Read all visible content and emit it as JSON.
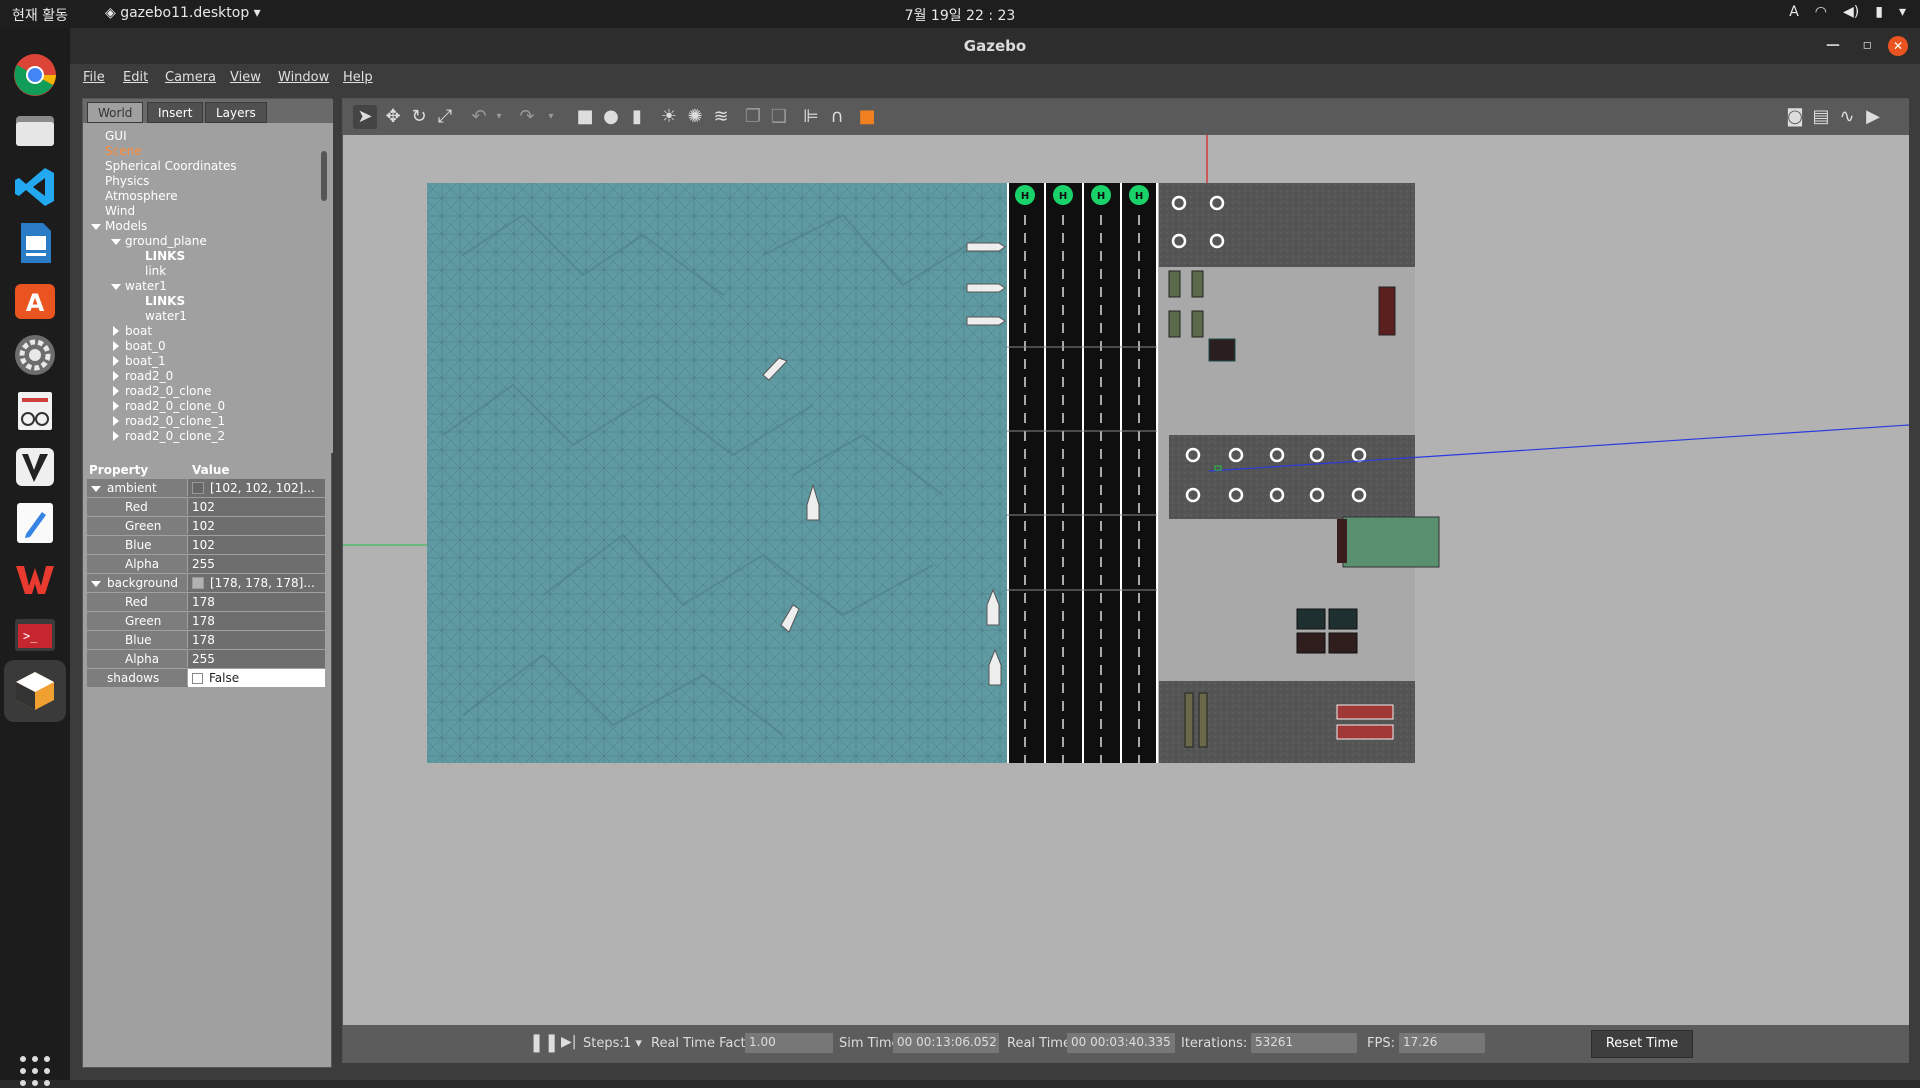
{
  "topbar": {
    "activities": "현재 활동",
    "app_name": "gazebo11.desktop",
    "clock": "7월 19일  22 : 23",
    "tray_input": "A"
  },
  "window": {
    "title": "Gazebo"
  },
  "menu": {
    "file": "File",
    "edit": "Edit",
    "camera": "Camera",
    "view": "View",
    "window": "Window",
    "help": "Help"
  },
  "tabs": {
    "world": "World",
    "insert": "Insert",
    "layers": "Layers"
  },
  "tree": {
    "gui": "GUI",
    "scene": "Scene",
    "spherical": "Spherical Coordinates",
    "physics": "Physics",
    "atmosphere": "Atmosphere",
    "wind": "Wind",
    "models": "Models",
    "ground_plane": "ground_plane",
    "links_1": "LINKS",
    "link": "link",
    "water1": "water1",
    "links_2": "LINKS",
    "water1_link": "water1",
    "boat": "boat",
    "boat_0": "boat_0",
    "boat_1": "boat_1",
    "road2_0": "road2_0",
    "road2_0_clone": "road2_0_clone",
    "road2_0_clone_0": "road2_0_clone_0",
    "road2_0_clone_1": "road2_0_clone_1",
    "road2_0_clone_2": "road2_0_clone_2"
  },
  "props": {
    "header_key": "Property",
    "header_val": "Value",
    "ambient": "ambient",
    "ambient_val": "[102, 102, 102]...",
    "red1": "Red",
    "red1_val": "102",
    "green1": "Green",
    "green1_val": "102",
    "blue1": "Blue",
    "blue1_val": "102",
    "alpha1": "Alpha",
    "alpha1_val": "255",
    "background": "background",
    "background_val": "[178, 178, 178]...",
    "red2": "Red",
    "red2_val": "178",
    "green2": "Green",
    "green2_val": "178",
    "blue2": "Blue",
    "blue2_val": "178",
    "alpha2": "Alpha",
    "alpha2_val": "255",
    "shadows": "shadows",
    "shadows_val": "False"
  },
  "bottom": {
    "steps_label": "Steps:",
    "steps_val": "1",
    "rtf_label": "Real Time Factor:",
    "rtf_val": "1.00",
    "sim_label": "Sim Time:",
    "sim_val": "00 00:13:06.052",
    "real_label": "Real Time:",
    "real_val": "00 00:03:40.335",
    "iter_label": "Iterations:",
    "iter_val": "53261",
    "fps_label": "FPS:",
    "fps_val": "17.26",
    "reset": "Reset Time"
  },
  "helipad_letter": "H",
  "colors": {
    "water": "#5f9aa3",
    "road": "#0f0f0f",
    "helipad": "#19d26a",
    "scene_selected": "#ff8c3a",
    "close": "#e95420"
  }
}
